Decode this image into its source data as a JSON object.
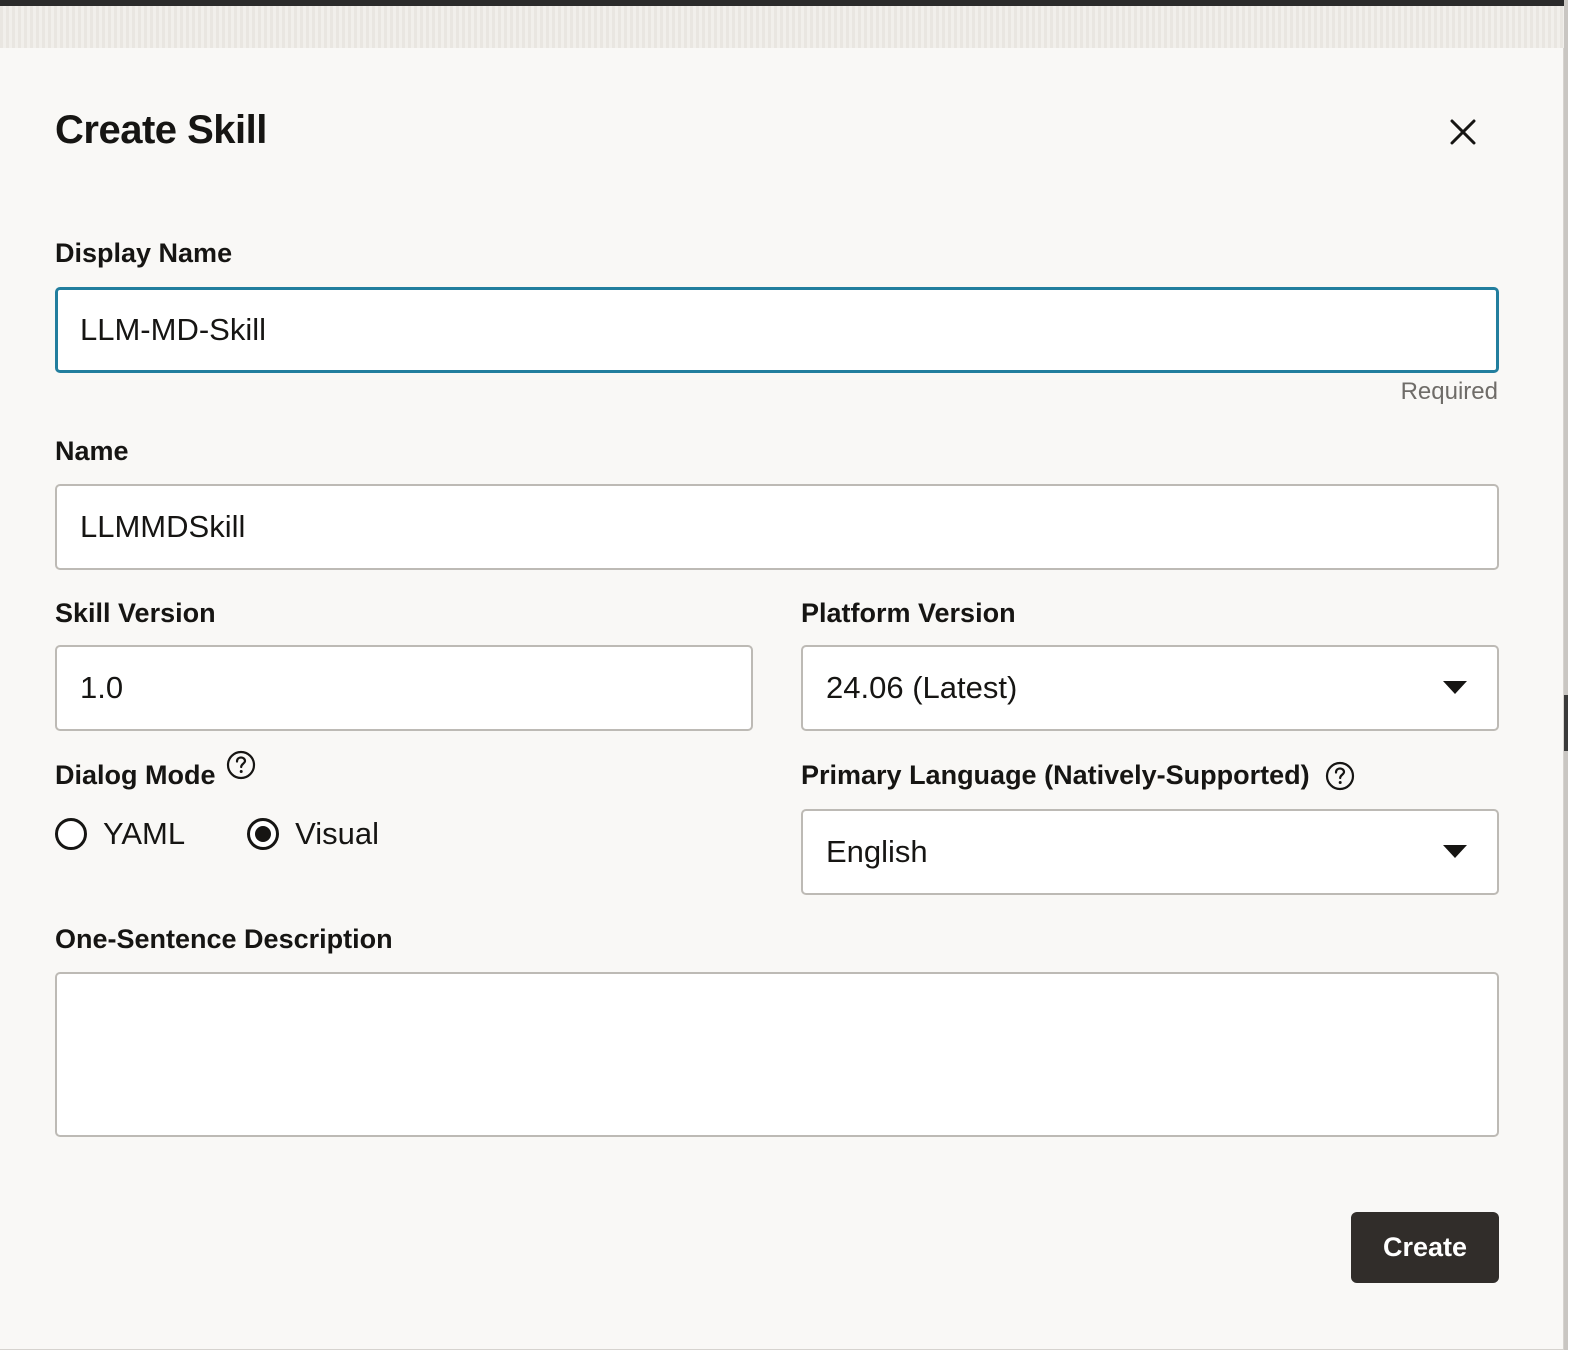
{
  "dialog": {
    "title": "Create Skill",
    "close_icon": "close-icon"
  },
  "display_name": {
    "label": "Display Name",
    "value": "LLM-MD-Skill",
    "hint": "Required"
  },
  "name": {
    "label": "Name",
    "value": "LLMMDSkill"
  },
  "skill_version": {
    "label": "Skill Version",
    "value": "1.0"
  },
  "platform_version": {
    "label": "Platform Version",
    "selected": "24.06 (Latest)"
  },
  "dialog_mode": {
    "label": "Dialog Mode",
    "options": [
      {
        "label": "YAML",
        "selected": false
      },
      {
        "label": "Visual",
        "selected": true
      }
    ]
  },
  "primary_language": {
    "label": "Primary Language (Natively-Supported)",
    "selected": "English"
  },
  "description": {
    "label": "One-Sentence Description",
    "value": ""
  },
  "actions": {
    "create_label": "Create"
  },
  "colors": {
    "focus_border": "#227e9e",
    "primary_button": "#312d2a",
    "dialog_background": "#f9f8f6"
  }
}
